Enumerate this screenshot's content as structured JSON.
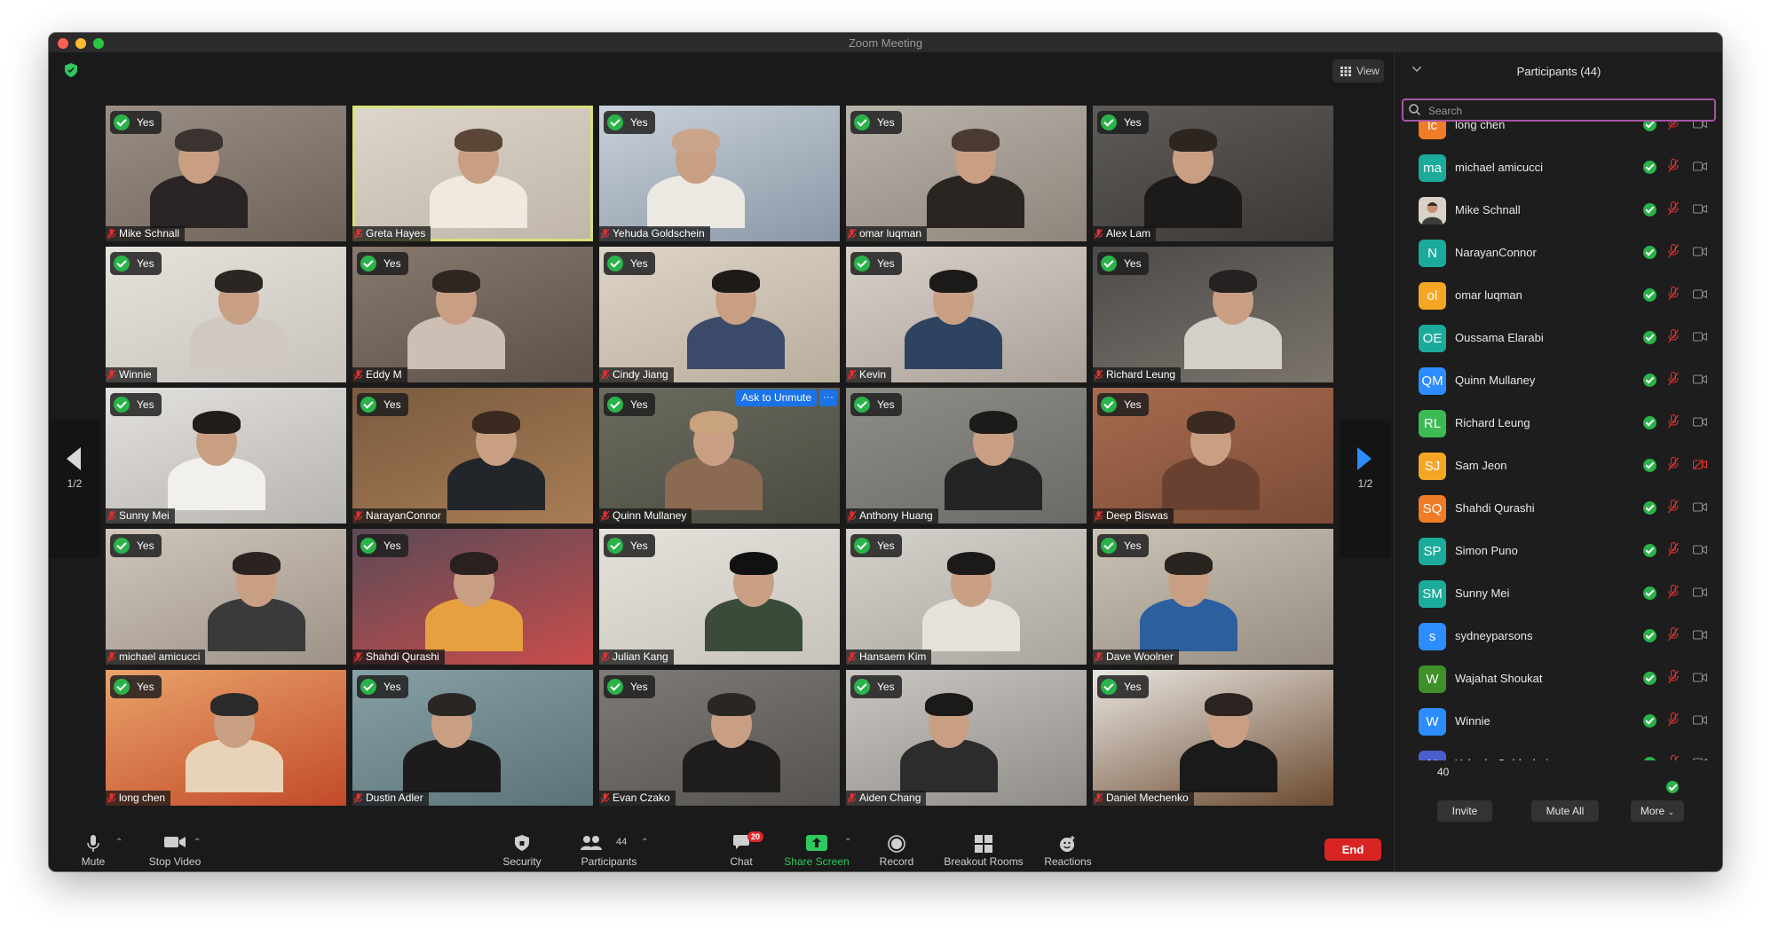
{
  "window": {
    "title": "Zoom Meeting"
  },
  "top": {
    "view_label": "View"
  },
  "page_nav": {
    "left_label": "1/2",
    "right_label": "1/2"
  },
  "tiles": [
    {
      "name": "Mike Schnall",
      "status": "Yes"
    },
    {
      "name": "Greta Hayes",
      "status": ""
    },
    {
      "name": "Yehuda Goldschein",
      "status": "Yes"
    },
    {
      "name": "omar luqman",
      "status": "Yes"
    },
    {
      "name": "Alex Lam",
      "status": "Yes"
    },
    {
      "name": "Winnie",
      "status": "Yes"
    },
    {
      "name": "Eddy M",
      "status": "Yes"
    },
    {
      "name": "Cindy Jiang",
      "status": "Yes"
    },
    {
      "name": "Kevin",
      "status": "Yes"
    },
    {
      "name": "Richard Leung",
      "status": "Yes"
    },
    {
      "name": "Sunny Mei",
      "status": "Yes"
    },
    {
      "name": "NarayanConnor",
      "status": "Yes"
    },
    {
      "name": "Quinn Mullaney",
      "status": "Yes"
    },
    {
      "name": "Anthony Huang",
      "status": "Yes"
    },
    {
      "name": "Deep Biswas",
      "status": "Yes"
    },
    {
      "name": "michael amicucci",
      "status": "Yes"
    },
    {
      "name": "Shahdi Qurashi",
      "status": "Yes"
    },
    {
      "name": "Julian Kang",
      "status": "Yes"
    },
    {
      "name": "Hansaem Kim",
      "status": "Yes"
    },
    {
      "name": "Dave Woolner",
      "status": "Yes"
    },
    {
      "name": "long chen",
      "status": "Yes"
    },
    {
      "name": "Dustin Adler",
      "status": "Yes"
    },
    {
      "name": "Evan Czako",
      "status": "Yes"
    },
    {
      "name": "Aiden Chang",
      "status": "Yes"
    },
    {
      "name": "Daniel Mechenko",
      "status": "Yes"
    }
  ],
  "ask_unmute": {
    "label": "Ask to Unmute",
    "more": "···"
  },
  "toolbar": {
    "mute": "Mute",
    "stop_video": "Stop Video",
    "security": "Security",
    "participants": "Participants",
    "participants_count": "44",
    "chat": "Chat",
    "chat_badge": "20",
    "share_screen": "Share Screen",
    "record": "Record",
    "breakout_rooms": "Breakout Rooms",
    "reactions": "Reactions",
    "end": "End"
  },
  "panel": {
    "title": "Participants (44)",
    "search_placeholder": "Search",
    "participants": [
      {
        "initials": "lc",
        "name": "long chen",
        "color": "#f07c28",
        "camera_off": false
      },
      {
        "initials": "ma",
        "name": "michael amicucci",
        "color": "#1bab9b",
        "camera_off": false
      },
      {
        "initials": "",
        "name": "Mike Schnall",
        "color": "#8a6e5a",
        "camera_off": false
      },
      {
        "initials": "N",
        "name": "NarayanConnor",
        "color": "#1bab9b",
        "camera_off": false
      },
      {
        "initials": "ol",
        "name": "omar luqman",
        "color": "#f5a623",
        "camera_off": false
      },
      {
        "initials": "OE",
        "name": "Oussama Elarabi",
        "color": "#1bab9b",
        "camera_off": false
      },
      {
        "initials": "QM",
        "name": "Quinn Mullaney",
        "color": "#2d8cff",
        "camera_off": false
      },
      {
        "initials": "RL",
        "name": "Richard Leung",
        "color": "#3cba54",
        "camera_off": false
      },
      {
        "initials": "SJ",
        "name": "Sam Jeon",
        "color": "#f5a623",
        "camera_off": true
      },
      {
        "initials": "SQ",
        "name": "Shahdi Qurashi",
        "color": "#f07c28",
        "camera_off": false
      },
      {
        "initials": "SP",
        "name": "Simon Puno",
        "color": "#1bab9b",
        "camera_off": false
      },
      {
        "initials": "SM",
        "name": "Sunny Mei",
        "color": "#1bab9b",
        "camera_off": false
      },
      {
        "initials": "s",
        "name": "sydneyparsons",
        "color": "#2d8cff",
        "camera_off": false
      },
      {
        "initials": "W",
        "name": "Wajahat Shoukat",
        "color": "#3f8f2a",
        "camera_off": false
      },
      {
        "initials": "W",
        "name": "Winnie",
        "color": "#2d8cff",
        "camera_off": false
      },
      {
        "initials": "Y",
        "name": "Yehuda Goldschein",
        "color": "#4a5fcf",
        "camera_off": false
      }
    ],
    "yes_count": "40",
    "invite": "Invite",
    "mute_all": "Mute All",
    "more": "More"
  }
}
